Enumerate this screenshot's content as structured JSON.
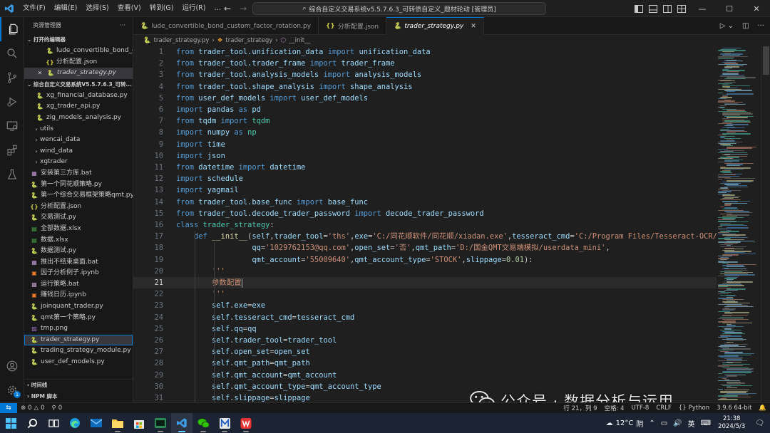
{
  "window": {
    "menu": [
      "文件(F)",
      "编辑(E)",
      "选择(S)",
      "查看(V)",
      "转到(G)",
      "运行(R)",
      "…"
    ],
    "search_text": "综合自定义交易系统v5.5.7.6.3_可转债自定义_题材轮动 [管理员]"
  },
  "sidebar": {
    "title": "资源管理器",
    "open_editors_header": "打开的编辑器",
    "open_editors": [
      {
        "name": "lude_convertible_bond_c...",
        "icon": "python-icon"
      },
      {
        "name": "分析配置.json",
        "icon": "json-icon"
      },
      {
        "name": "trader_strategy.py",
        "icon": "python-icon"
      }
    ],
    "workspace_header": "综合自定义交易系统V5.5.7.6.3_可转...",
    "files": [
      {
        "name": "xg_financial_database.py",
        "type": "file",
        "icon": "python-icon"
      },
      {
        "name": "xg_trader_api.py",
        "type": "file",
        "icon": "python-icon"
      },
      {
        "name": "zig_models_analysis.py",
        "type": "file",
        "icon": "python-icon"
      },
      {
        "name": "utils",
        "type": "folder"
      },
      {
        "name": "wencai_data",
        "type": "folder"
      },
      {
        "name": "wind_data",
        "type": "folder"
      },
      {
        "name": "xgtrader",
        "type": "folder"
      },
      {
        "name": "安装第三方库.bat",
        "type": "file",
        "icon": "bat-icon"
      },
      {
        "name": "第一个同花顺策略.py",
        "type": "file",
        "icon": "python-icon"
      },
      {
        "name": "第一个综合交易框架策略qmt.py",
        "type": "file",
        "icon": "python-icon"
      },
      {
        "name": "分析配置.json",
        "type": "file",
        "icon": "json-icon"
      },
      {
        "name": "交易测试.py",
        "type": "file",
        "icon": "python-icon"
      },
      {
        "name": "全部数据.xlsx",
        "type": "file",
        "icon": "excel-icon"
      },
      {
        "name": "数据.xlsx",
        "type": "file",
        "icon": "excel-icon"
      },
      {
        "name": "数据测试.py",
        "type": "file",
        "icon": "python-icon"
      },
      {
        "name": "推出不结束桌面.bat",
        "type": "file",
        "icon": "bat-icon"
      },
      {
        "name": "因子分析例子.ipynb",
        "type": "file",
        "icon": "notebook-icon"
      },
      {
        "name": "运行策略.bat",
        "type": "file",
        "icon": "bat-icon"
      },
      {
        "name": "赚钱日历.ipynb",
        "type": "file",
        "icon": "notebook-icon"
      },
      {
        "name": "joinquant_trader.py",
        "type": "file",
        "icon": "python-icon"
      },
      {
        "name": "qmt第一个策略.py",
        "type": "file",
        "icon": "python-icon"
      },
      {
        "name": "tmp.png",
        "type": "file",
        "icon": "image-icon"
      },
      {
        "name": "trader_strategy.py",
        "type": "file",
        "icon": "python-icon"
      },
      {
        "name": "trading_strategy_module.py",
        "type": "file",
        "icon": "python-icon"
      },
      {
        "name": "user_def_models.py",
        "type": "file",
        "icon": "python-icon"
      }
    ],
    "timeline_label": "时间线",
    "npm_label": "NPM 脚本"
  },
  "tabs": [
    {
      "label": "lude_convertible_bond_custom_factor_rotation.py",
      "icon": "python-icon",
      "active": false
    },
    {
      "label": "分析配置.json",
      "icon": "json-icon",
      "active": false
    },
    {
      "label": "trader_strategy.py",
      "icon": "python-icon",
      "active": true
    }
  ],
  "breadcrumb": {
    "file": "trader_strategy.py",
    "class": "trader_strategy",
    "method": "__init__"
  },
  "editor": {
    "current_line": 21,
    "lines": [
      [
        [
          "kw",
          "from "
        ],
        [
          "id",
          "trader_tool.unification_data "
        ],
        [
          "kw",
          "import "
        ],
        [
          "id",
          "unification_data"
        ]
      ],
      [
        [
          "kw",
          "from "
        ],
        [
          "id",
          "trader_tool.trader_frame "
        ],
        [
          "kw",
          "import "
        ],
        [
          "id",
          "trader_frame"
        ]
      ],
      [
        [
          "kw",
          "from "
        ],
        [
          "id",
          "trader_tool.analysis_models "
        ],
        [
          "kw",
          "import "
        ],
        [
          "id",
          "analysis_models"
        ]
      ],
      [
        [
          "kw",
          "from "
        ],
        [
          "id",
          "trader_tool.shape_analysis "
        ],
        [
          "kw",
          "import "
        ],
        [
          "id",
          "shape_analysis"
        ]
      ],
      [
        [
          "kw",
          "from "
        ],
        [
          "id",
          "user_def_models "
        ],
        [
          "kw",
          "import "
        ],
        [
          "id",
          "user_def_models"
        ]
      ],
      [
        [
          "kw",
          "import "
        ],
        [
          "id",
          "pandas "
        ],
        [
          "kw",
          "as "
        ],
        [
          "id",
          "pd"
        ]
      ],
      [
        [
          "kw",
          "from "
        ],
        [
          "id",
          "tqdm "
        ],
        [
          "kw",
          "import "
        ],
        [
          "mod",
          "tqdm"
        ]
      ],
      [
        [
          "kw",
          "import "
        ],
        [
          "id",
          "numpy "
        ],
        [
          "kw",
          "as "
        ],
        [
          "mod",
          "np"
        ]
      ],
      [
        [
          "kw",
          "import "
        ],
        [
          "id",
          "time"
        ]
      ],
      [
        [
          "kw",
          "import "
        ],
        [
          "id",
          "json"
        ]
      ],
      [
        [
          "kw",
          "from "
        ],
        [
          "id",
          "datetime "
        ],
        [
          "kw",
          "import "
        ],
        [
          "id",
          "datetime"
        ]
      ],
      [
        [
          "kw",
          "import "
        ],
        [
          "id",
          "schedule"
        ]
      ],
      [
        [
          "kw",
          "import "
        ],
        [
          "id",
          "yagmail"
        ]
      ],
      [
        [
          "kw",
          "from "
        ],
        [
          "id",
          "trader_tool.base_func "
        ],
        [
          "kw",
          "import "
        ],
        [
          "id",
          "base_func"
        ]
      ],
      [
        [
          "kw",
          "from "
        ],
        [
          "id",
          "trader_tool.decode_trader_password "
        ],
        [
          "kw",
          "import "
        ],
        [
          "id",
          "decode_trader_password"
        ]
      ],
      [
        [
          "kw",
          "class "
        ],
        [
          "mod",
          "trader_strategy"
        ],
        [
          "op",
          ":"
        ]
      ],
      [
        [
          "op",
          "    "
        ],
        [
          "kw",
          "def "
        ],
        [
          "fn",
          "__init__"
        ],
        [
          "op",
          "("
        ],
        [
          "id",
          "self"
        ],
        [
          "op",
          ","
        ],
        [
          "id",
          "trader_tool"
        ],
        [
          "op",
          "="
        ],
        [
          "str",
          "'ths'"
        ],
        [
          "op",
          ","
        ],
        [
          "id",
          "exe"
        ],
        [
          "op",
          "="
        ],
        [
          "str",
          "'C:/同花顺软件/同花顺/xiadan.exe'"
        ],
        [
          "op",
          ","
        ],
        [
          "id",
          "tesseract_cmd"
        ],
        [
          "op",
          "="
        ],
        [
          "str",
          "'C:/Program Files/Tesseract-OCR/tesseract'"
        ]
      ],
      [
        [
          "op",
          "                 "
        ],
        [
          "id",
          "qq"
        ],
        [
          "op",
          "="
        ],
        [
          "str",
          "'1029762153@qq.com'"
        ],
        [
          "op",
          ","
        ],
        [
          "id",
          "open_set"
        ],
        [
          "op",
          "="
        ],
        [
          "str",
          "'否'"
        ],
        [
          "op",
          ","
        ],
        [
          "id",
          "qmt_path"
        ],
        [
          "op",
          "="
        ],
        [
          "str",
          "'D:/国金QMT交易端模拟/userdata_mini'"
        ],
        [
          "op",
          ","
        ]
      ],
      [
        [
          "op",
          "                 "
        ],
        [
          "id",
          "qmt_account"
        ],
        [
          "op",
          "="
        ],
        [
          "str",
          "'55009640'"
        ],
        [
          "op",
          ","
        ],
        [
          "id",
          "qmt_account_type"
        ],
        [
          "op",
          "="
        ],
        [
          "str",
          "'STOCK'"
        ],
        [
          "op",
          ","
        ],
        [
          "id",
          "slippage"
        ],
        [
          "op",
          "="
        ],
        [
          "num",
          "0.01"
        ],
        [
          "op",
          "):"
        ]
      ],
      [
        [
          "op",
          "        "
        ],
        [
          "str",
          "'''"
        ]
      ],
      [
        [
          "op",
          "        "
        ],
        [
          "str",
          "参数配置"
        ],
        [
          "caret",
          ""
        ]
      ],
      [
        [
          "op",
          "        "
        ],
        [
          "str",
          "'''"
        ]
      ],
      [
        [
          "op",
          "        "
        ],
        [
          "id",
          "self"
        ],
        [
          "op",
          "."
        ],
        [
          "id",
          "exe"
        ],
        [
          "op",
          "="
        ],
        [
          "id",
          "exe"
        ]
      ],
      [
        [
          "op",
          "        "
        ],
        [
          "id",
          "self"
        ],
        [
          "op",
          "."
        ],
        [
          "id",
          "tesseract_cmd"
        ],
        [
          "op",
          "="
        ],
        [
          "id",
          "tesseract_cmd"
        ]
      ],
      [
        [
          "op",
          "        "
        ],
        [
          "id",
          "self"
        ],
        [
          "op",
          "."
        ],
        [
          "id",
          "qq"
        ],
        [
          "op",
          "="
        ],
        [
          "id",
          "qq"
        ]
      ],
      [
        [
          "op",
          "        "
        ],
        [
          "id",
          "self"
        ],
        [
          "op",
          "."
        ],
        [
          "id",
          "trader_tool"
        ],
        [
          "op",
          "="
        ],
        [
          "id",
          "trader_tool"
        ]
      ],
      [
        [
          "op",
          "        "
        ],
        [
          "id",
          "self"
        ],
        [
          "op",
          "."
        ],
        [
          "id",
          "open_set"
        ],
        [
          "op",
          "="
        ],
        [
          "id",
          "open_set"
        ]
      ],
      [
        [
          "op",
          "        "
        ],
        [
          "id",
          "self"
        ],
        [
          "op",
          "."
        ],
        [
          "id",
          "qmt_path"
        ],
        [
          "op",
          "="
        ],
        [
          "id",
          "qmt_path"
        ]
      ],
      [
        [
          "op",
          "        "
        ],
        [
          "id",
          "self"
        ],
        [
          "op",
          "."
        ],
        [
          "id",
          "qmt_account"
        ],
        [
          "op",
          "="
        ],
        [
          "id",
          "qmt_account"
        ]
      ],
      [
        [
          "op",
          "        "
        ],
        [
          "id",
          "self"
        ],
        [
          "op",
          "."
        ],
        [
          "id",
          "qmt_account_type"
        ],
        [
          "op",
          "="
        ],
        [
          "id",
          "qmt_account_type"
        ]
      ],
      [
        [
          "op",
          "        "
        ],
        [
          "id",
          "self"
        ],
        [
          "op",
          "."
        ],
        [
          "id",
          "slippage"
        ],
        [
          "op",
          "="
        ],
        [
          "id",
          "slippage"
        ]
      ]
    ]
  },
  "watermark": {
    "text": "公众号 · 数据分析与运用"
  },
  "statusbar": {
    "errors": "0",
    "warnings": "0",
    "ports": "0",
    "position": "行 21，列 9",
    "spaces": "空格: 4",
    "encoding": "UTF-8",
    "eol": "CRLF",
    "language": "Python",
    "interpreter": "3.9.6 64-bit"
  },
  "taskbar": {
    "weather_temp": "12°C",
    "weather_desc": "阴",
    "ime": "英",
    "time": "21:38",
    "date": "2024/5/3",
    "notification_count": "1"
  },
  "colors": {
    "accent": "#0078d4",
    "editor_bg": "#1f1f1f",
    "keyword": "#569cd6",
    "string": "#ce9178"
  }
}
